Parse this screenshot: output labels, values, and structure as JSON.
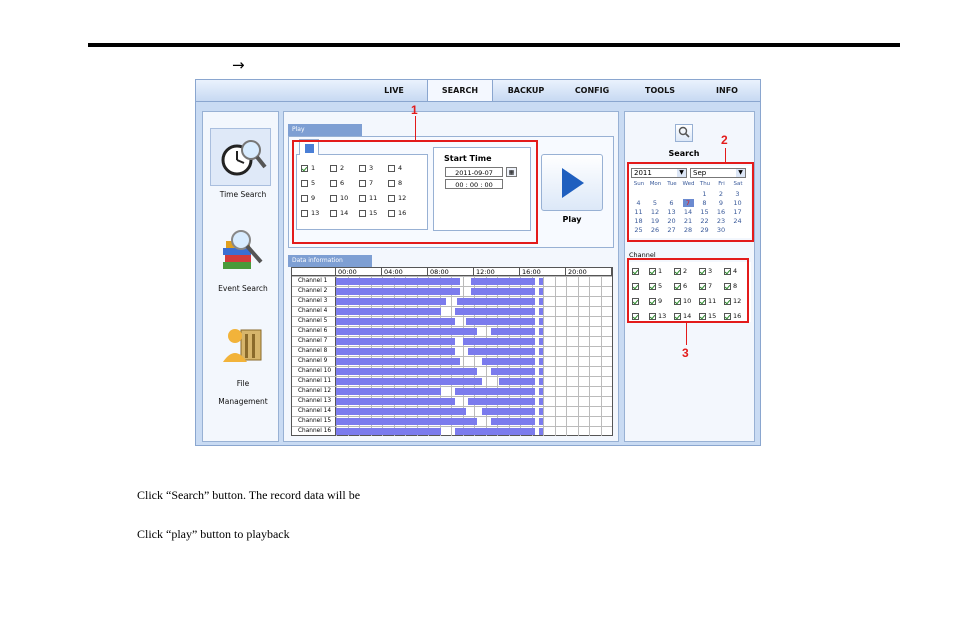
{
  "page": {
    "arrow": "→",
    "line1": "Click “Search” button. The record data will be",
    "line2": "Click “play” button to playback"
  },
  "nav": {
    "tabs": [
      {
        "label": "LIVE",
        "active": false
      },
      {
        "label": "SEARCH",
        "active": true
      },
      {
        "label": "BACKUP",
        "active": false
      },
      {
        "label": "CONFIG",
        "active": false
      },
      {
        "label": "TOOLS",
        "active": false
      },
      {
        "label": "INFO",
        "active": false
      }
    ]
  },
  "sidebar": {
    "items": [
      {
        "label": "Time Search",
        "icon": "clock-magnifier-icon"
      },
      {
        "label": "Event Search",
        "icon": "books-magnifier-icon"
      },
      {
        "label": "File",
        "label2": "Management",
        "icon": "user-folder-icon"
      }
    ]
  },
  "play_panel": {
    "tab_label": "Play",
    "start_time_label": "Start Time",
    "date_value": "2011-09-07",
    "time_value": "00 : 00 : 00",
    "play_label": "Play",
    "channels": [
      "1",
      "2",
      "3",
      "4",
      "5",
      "6",
      "7",
      "8",
      "9",
      "10",
      "11",
      "12",
      "13",
      "14",
      "15",
      "16"
    ],
    "checked": [
      "1"
    ]
  },
  "data_info": {
    "tab_label": "Data information",
    "hours": [
      "00:00",
      "04:00",
      "08:00",
      "12:00",
      "16:00",
      "20:00"
    ],
    "rows": [
      {
        "label": "Channel 1"
      },
      {
        "label": "Channel 2"
      },
      {
        "label": "Channel 3"
      },
      {
        "label": "Channel 4"
      },
      {
        "label": "Channel 5"
      },
      {
        "label": "Channel 6"
      },
      {
        "label": "Channel 7"
      },
      {
        "label": "Channel 8"
      },
      {
        "label": "Channel 9"
      },
      {
        "label": "Channel 10"
      },
      {
        "label": "Channel 11"
      },
      {
        "label": "Channel 12"
      },
      {
        "label": "Channel 13"
      },
      {
        "label": "Channel 14"
      },
      {
        "label": "Channel 15"
      },
      {
        "label": "Channel 16"
      }
    ],
    "record_color": "#7b7bed"
  },
  "search_panel": {
    "search_label": "Search",
    "year": "2011",
    "month": "Sep",
    "weekdays": [
      "Sun",
      "Mon",
      "Tue",
      "Wed",
      "Thu",
      "Fri",
      "Sat"
    ],
    "days": [
      "1",
      "2",
      "3",
      "4",
      "5",
      "6",
      "7",
      "8",
      "9",
      "10",
      "11",
      "12",
      "13",
      "14",
      "15",
      "16",
      "17",
      "18",
      "19",
      "20",
      "21",
      "22",
      "23",
      "24",
      "25",
      "26",
      "27",
      "28",
      "29",
      "30"
    ],
    "first_weekday": 4,
    "selected_day": "7",
    "channel_label": "Channel",
    "channels": [
      "1",
      "2",
      "3",
      "4",
      "5",
      "6",
      "7",
      "8",
      "9",
      "10",
      "11",
      "12",
      "13",
      "14",
      "15",
      "16"
    ]
  },
  "annotations": [
    "1",
    "2",
    "3"
  ],
  "colors": {
    "accent": "#e31b1b",
    "record": "#7b7bed",
    "selected_day": "#6b8ad0"
  }
}
